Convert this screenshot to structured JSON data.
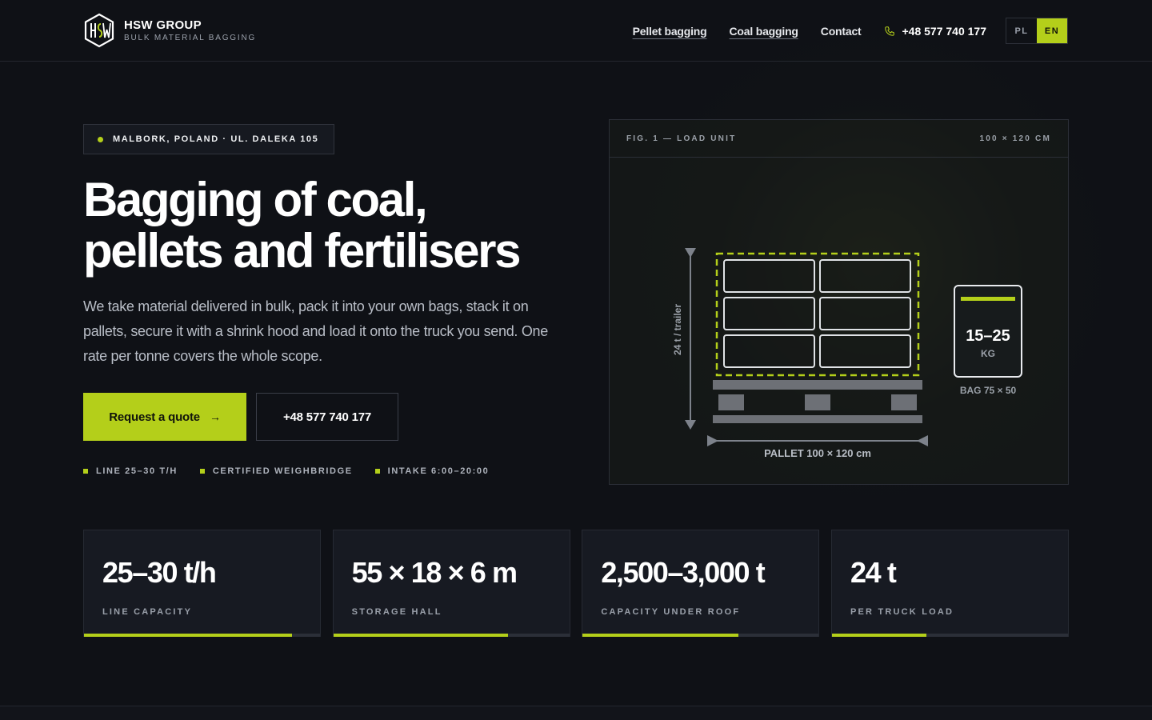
{
  "header": {
    "logo_name": "HSW GROUP",
    "logo_sub": "BULK MATERIAL BAGGING",
    "nav": [
      "Pellet bagging",
      "Coal bagging",
      "Contact"
    ],
    "phone": "+48 577 740 177",
    "lang": {
      "pl": "PL",
      "en": "EN",
      "active": "EN"
    }
  },
  "hero": {
    "location": "MALBORK, POLAND · UL. DALEKA 105",
    "title_line1": "Bagging of coal,",
    "title_line2": "pellets and fertilisers",
    "lead": "We take material delivered in bulk, pack it into your own bags, stack it on pallets, secure it with a shrink hood and load it onto the truck you send. One rate per tonne covers the whole scope.",
    "cta_primary": "Request a quote",
    "cta_secondary": "+48 577 740 177",
    "features": [
      "LINE 25–30 T/H",
      "CERTIFIED WEIGHBRIDGE",
      "INTAKE 6:00–20:00"
    ]
  },
  "figure": {
    "title": "FIG. 1 — LOAD UNIT",
    "dims": "100 × 120 CM",
    "height_label": "24 t / trailer",
    "pallet_label": "PALLET 100 × 120 cm",
    "bag_weight": "15–25",
    "bag_unit": "KG",
    "bag_label": "BAG 75 × 50"
  },
  "stats": [
    {
      "value": "25–30 t/h",
      "label": "LINE CAPACITY",
      "fill": 0.88
    },
    {
      "value": "55 × 18 × 6 m",
      "label": "STORAGE HALL",
      "fill": 0.74
    },
    {
      "value": "2,500–3,000 t",
      "label": "CAPACITY UNDER ROOF",
      "fill": 0.66
    },
    {
      "value": "24 t",
      "label": "PER TRUCK LOAD",
      "fill": 0.4
    }
  ],
  "colors": {
    "accent": "#b4cf1a",
    "background": "#0f1116",
    "card": "#171a22"
  }
}
